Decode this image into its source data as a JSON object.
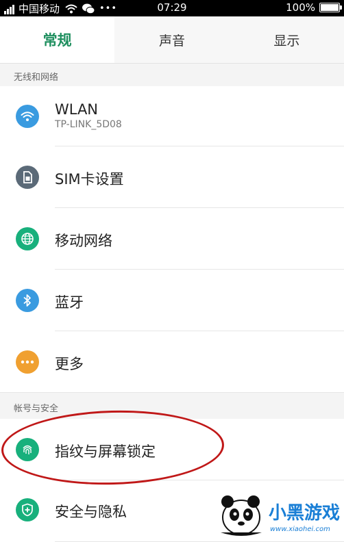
{
  "status_bar": {
    "carrier": "中国移动",
    "time": "07:29",
    "battery": "100%"
  },
  "tabs": [
    {
      "label": "常规",
      "active": true
    },
    {
      "label": "声音",
      "active": false
    },
    {
      "label": "显示",
      "active": false
    }
  ],
  "sections": {
    "wireless": "无线和网络",
    "account": "帐号与安全"
  },
  "items": {
    "wlan": {
      "title": "WLAN",
      "subtitle": "TP-LINK_5D08",
      "icon": "wifi-icon",
      "color": "#3a9be0"
    },
    "sim": {
      "title": "SIM卡设置",
      "icon": "sim-card-icon",
      "color": "#5b6a78"
    },
    "mobile": {
      "title": "移动网络",
      "icon": "globe-icon",
      "color": "#18b07c"
    },
    "bluetooth": {
      "title": "蓝牙",
      "icon": "bluetooth-icon",
      "color": "#3a9be0"
    },
    "more": {
      "title": "更多",
      "icon": "more-dots-icon",
      "color": "#f0a030"
    },
    "fingerprint": {
      "title": "指纹与屏幕锁定",
      "icon": "fingerprint-icon",
      "color": "#18b07c"
    },
    "privacy": {
      "title": "安全与隐私",
      "icon": "shield-icon",
      "color": "#18b07c"
    }
  },
  "annotation_color": "#c01818",
  "watermark": {
    "logo_text": "小黑游戏",
    "url": "www.xiaohei.com"
  }
}
